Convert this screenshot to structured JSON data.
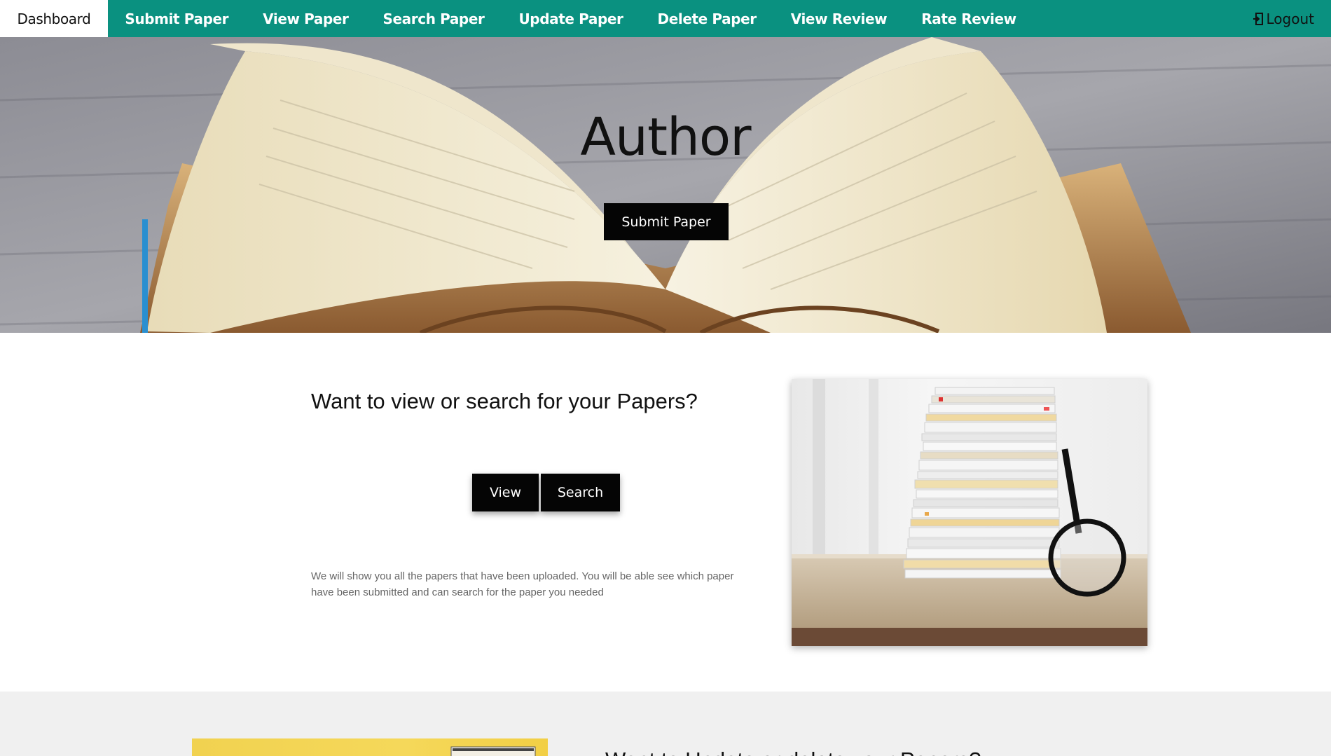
{
  "nav": {
    "items": [
      {
        "label": "Dashboard",
        "active": true
      },
      {
        "label": "Submit Paper",
        "active": false
      },
      {
        "label": "View Paper",
        "active": false
      },
      {
        "label": "Search Paper",
        "active": false
      },
      {
        "label": "Update Paper",
        "active": false
      },
      {
        "label": "Delete Paper",
        "active": false
      },
      {
        "label": "View Review",
        "active": false
      },
      {
        "label": "Rate Review",
        "active": false
      }
    ],
    "logout_label": "Logout",
    "logout_icon": "logout-icon",
    "background_color": "#0a9180"
  },
  "hero": {
    "title": "Author",
    "button_label": "Submit Paper",
    "image": "open-book-photo"
  },
  "section1": {
    "heading": "Want to view or search for your Papers?",
    "view_label": "View",
    "search_label": "Search",
    "description": "We will show you all the papers that have been uploaded. You will be able see which paper have been submitted and can search for the paper you needed",
    "image": "paper-stack-with-magnifier-photo"
  },
  "section2": {
    "heading": "Want to Update or delete your Papers?",
    "image": "yellow-folder-photo"
  }
}
